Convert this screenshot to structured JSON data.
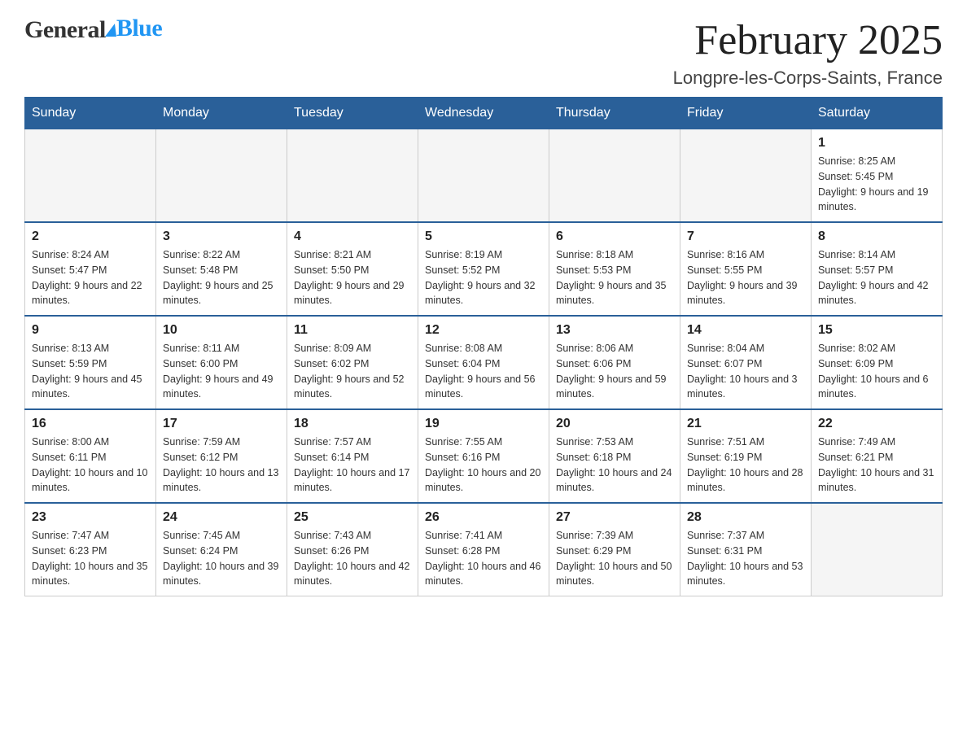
{
  "header": {
    "logo_general": "General",
    "logo_blue": "Blue",
    "month_title": "February 2025",
    "location": "Longpre-les-Corps-Saints, France"
  },
  "weekdays": [
    "Sunday",
    "Monday",
    "Tuesday",
    "Wednesday",
    "Thursday",
    "Friday",
    "Saturday"
  ],
  "weeks": [
    [
      {
        "day": "",
        "info": ""
      },
      {
        "day": "",
        "info": ""
      },
      {
        "day": "",
        "info": ""
      },
      {
        "day": "",
        "info": ""
      },
      {
        "day": "",
        "info": ""
      },
      {
        "day": "",
        "info": ""
      },
      {
        "day": "1",
        "info": "Sunrise: 8:25 AM\nSunset: 5:45 PM\nDaylight: 9 hours and 19 minutes."
      }
    ],
    [
      {
        "day": "2",
        "info": "Sunrise: 8:24 AM\nSunset: 5:47 PM\nDaylight: 9 hours and 22 minutes."
      },
      {
        "day": "3",
        "info": "Sunrise: 8:22 AM\nSunset: 5:48 PM\nDaylight: 9 hours and 25 minutes."
      },
      {
        "day": "4",
        "info": "Sunrise: 8:21 AM\nSunset: 5:50 PM\nDaylight: 9 hours and 29 minutes."
      },
      {
        "day": "5",
        "info": "Sunrise: 8:19 AM\nSunset: 5:52 PM\nDaylight: 9 hours and 32 minutes."
      },
      {
        "day": "6",
        "info": "Sunrise: 8:18 AM\nSunset: 5:53 PM\nDaylight: 9 hours and 35 minutes."
      },
      {
        "day": "7",
        "info": "Sunrise: 8:16 AM\nSunset: 5:55 PM\nDaylight: 9 hours and 39 minutes."
      },
      {
        "day": "8",
        "info": "Sunrise: 8:14 AM\nSunset: 5:57 PM\nDaylight: 9 hours and 42 minutes."
      }
    ],
    [
      {
        "day": "9",
        "info": "Sunrise: 8:13 AM\nSunset: 5:59 PM\nDaylight: 9 hours and 45 minutes."
      },
      {
        "day": "10",
        "info": "Sunrise: 8:11 AM\nSunset: 6:00 PM\nDaylight: 9 hours and 49 minutes."
      },
      {
        "day": "11",
        "info": "Sunrise: 8:09 AM\nSunset: 6:02 PM\nDaylight: 9 hours and 52 minutes."
      },
      {
        "day": "12",
        "info": "Sunrise: 8:08 AM\nSunset: 6:04 PM\nDaylight: 9 hours and 56 minutes."
      },
      {
        "day": "13",
        "info": "Sunrise: 8:06 AM\nSunset: 6:06 PM\nDaylight: 9 hours and 59 minutes."
      },
      {
        "day": "14",
        "info": "Sunrise: 8:04 AM\nSunset: 6:07 PM\nDaylight: 10 hours and 3 minutes."
      },
      {
        "day": "15",
        "info": "Sunrise: 8:02 AM\nSunset: 6:09 PM\nDaylight: 10 hours and 6 minutes."
      }
    ],
    [
      {
        "day": "16",
        "info": "Sunrise: 8:00 AM\nSunset: 6:11 PM\nDaylight: 10 hours and 10 minutes."
      },
      {
        "day": "17",
        "info": "Sunrise: 7:59 AM\nSunset: 6:12 PM\nDaylight: 10 hours and 13 minutes."
      },
      {
        "day": "18",
        "info": "Sunrise: 7:57 AM\nSunset: 6:14 PM\nDaylight: 10 hours and 17 minutes."
      },
      {
        "day": "19",
        "info": "Sunrise: 7:55 AM\nSunset: 6:16 PM\nDaylight: 10 hours and 20 minutes."
      },
      {
        "day": "20",
        "info": "Sunrise: 7:53 AM\nSunset: 6:18 PM\nDaylight: 10 hours and 24 minutes."
      },
      {
        "day": "21",
        "info": "Sunrise: 7:51 AM\nSunset: 6:19 PM\nDaylight: 10 hours and 28 minutes."
      },
      {
        "day": "22",
        "info": "Sunrise: 7:49 AM\nSunset: 6:21 PM\nDaylight: 10 hours and 31 minutes."
      }
    ],
    [
      {
        "day": "23",
        "info": "Sunrise: 7:47 AM\nSunset: 6:23 PM\nDaylight: 10 hours and 35 minutes."
      },
      {
        "day": "24",
        "info": "Sunrise: 7:45 AM\nSunset: 6:24 PM\nDaylight: 10 hours and 39 minutes."
      },
      {
        "day": "25",
        "info": "Sunrise: 7:43 AM\nSunset: 6:26 PM\nDaylight: 10 hours and 42 minutes."
      },
      {
        "day": "26",
        "info": "Sunrise: 7:41 AM\nSunset: 6:28 PM\nDaylight: 10 hours and 46 minutes."
      },
      {
        "day": "27",
        "info": "Sunrise: 7:39 AM\nSunset: 6:29 PM\nDaylight: 10 hours and 50 minutes."
      },
      {
        "day": "28",
        "info": "Sunrise: 7:37 AM\nSunset: 6:31 PM\nDaylight: 10 hours and 53 minutes."
      },
      {
        "day": "",
        "info": ""
      }
    ]
  ]
}
